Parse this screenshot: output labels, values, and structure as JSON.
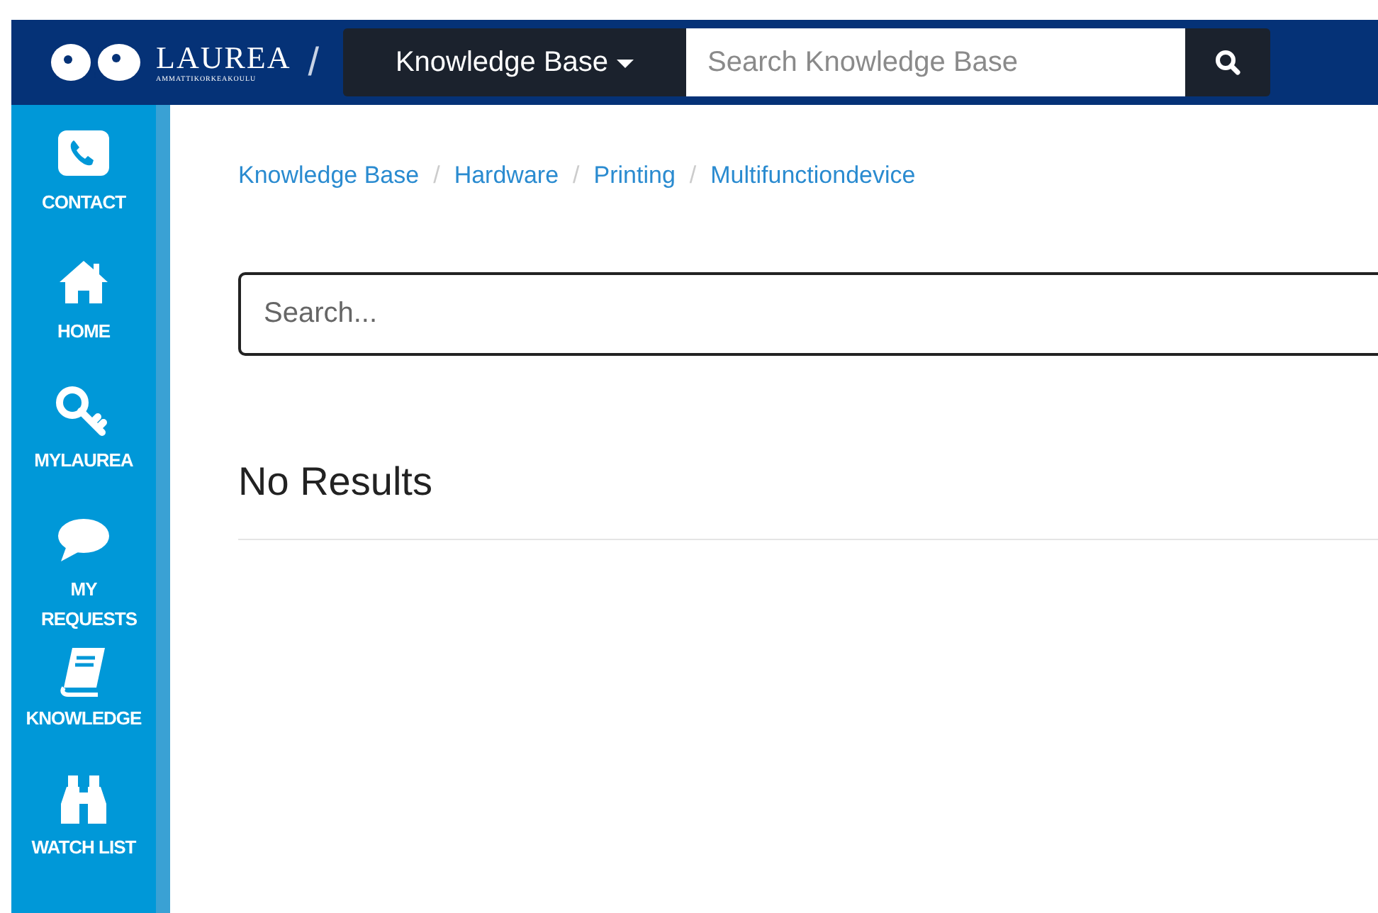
{
  "header": {
    "logo": {
      "name": "LAUREA",
      "subtitle": "AMMATTIKORKEAKOULU"
    },
    "separator": "/",
    "dropdown": {
      "label": "Knowledge Base"
    },
    "search": {
      "placeholder": "Search Knowledge Base"
    }
  },
  "sidebar": {
    "items": [
      {
        "kind": "phone",
        "label": "CONTACT"
      },
      {
        "kind": "home",
        "label": "HOME"
      },
      {
        "kind": "key",
        "label": "MYLAUREA"
      },
      {
        "kind": "chat",
        "label": "MY REQUESTS"
      },
      {
        "kind": "book",
        "label": "KNOWLEDGE"
      },
      {
        "kind": "binoculars",
        "label": "WATCH LIST"
      }
    ]
  },
  "breadcrumb": [
    "Knowledge Base",
    "Hardware",
    "Printing",
    "Multifunctiondevice"
  ],
  "search": {
    "placeholder": "Search..."
  },
  "results_heading": "No Results"
}
